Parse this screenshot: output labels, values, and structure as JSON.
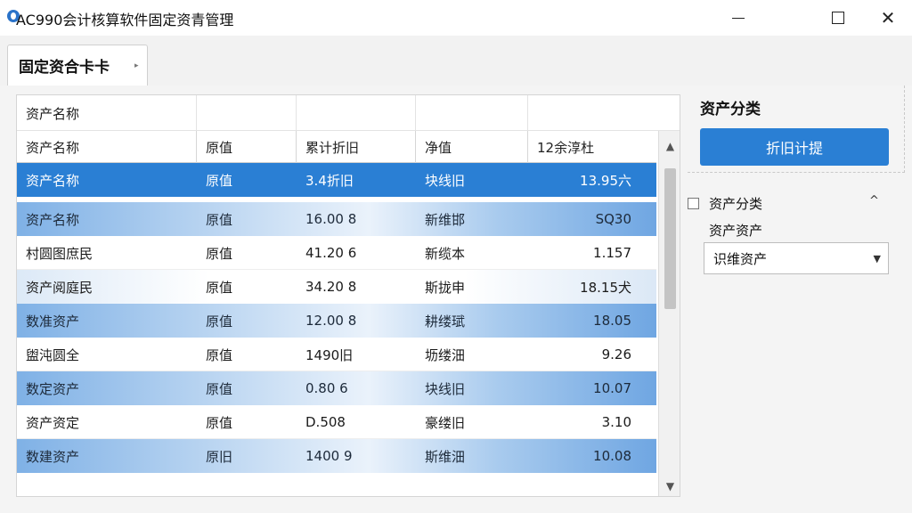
{
  "window": {
    "title": "AC990会计核算软件固定资青管理",
    "min_icon": "minimize-icon",
    "max_icon": "maximize-icon",
    "close_glyph": "✕"
  },
  "tab": {
    "label": "固定资合卡卡",
    "caret": "▸"
  },
  "grid": {
    "group_header": "资产名称",
    "columns": [
      "资产名称",
      "原值",
      "累计折旧",
      "净值",
      "12余淳杜"
    ],
    "rows": [
      {
        "style": "sel",
        "cells": [
          "资产名称",
          "原值",
          "3.4折旧",
          "块线旧",
          "13.95六"
        ]
      },
      {
        "style": "blue",
        "cells": [
          "资产名称",
          "原值",
          "16.00 8",
          "新维邯",
          "SQ30"
        ]
      },
      {
        "style": "plain",
        "cells": [
          "村圆图庶民",
          "原值",
          "41.20 6",
          "新缆本",
          "1.157"
        ]
      },
      {
        "style": "light",
        "cells": [
          "资产阅庭民",
          "原值",
          "34.20 8",
          "斯拢申",
          "18.15犬"
        ]
      },
      {
        "style": "blue",
        "cells": [
          "数准资产",
          "原值",
          "12.00 8",
          "耕缕珷",
          "18.05"
        ]
      },
      {
        "style": "plain",
        "cells": [
          "盥沌圆全",
          "原值",
          "1490旧",
          "坜缕沺",
          "9.26"
        ]
      },
      {
        "style": "blue",
        "cells": [
          "数定资产",
          "原值",
          "0.80 6",
          "块线旧",
          "10.07"
        ]
      },
      {
        "style": "plain",
        "cells": [
          "资产资定",
          "原值",
          "D.508",
          "豪缕旧",
          "3.10"
        ]
      },
      {
        "style": "blue",
        "cells": [
          "数建资产",
          "原旧",
          "1400 9",
          "斯维沺",
          "10.08"
        ]
      }
    ]
  },
  "side": {
    "title": "资产分类",
    "button": "折旧计提",
    "category_label": "资产分类",
    "sub_label": "资产资产",
    "select_value": "识维资产",
    "chevron": "^",
    "select_caret": "▼"
  },
  "colors": {
    "accent": "#2a7fd4",
    "band": "#7fb1e6"
  }
}
